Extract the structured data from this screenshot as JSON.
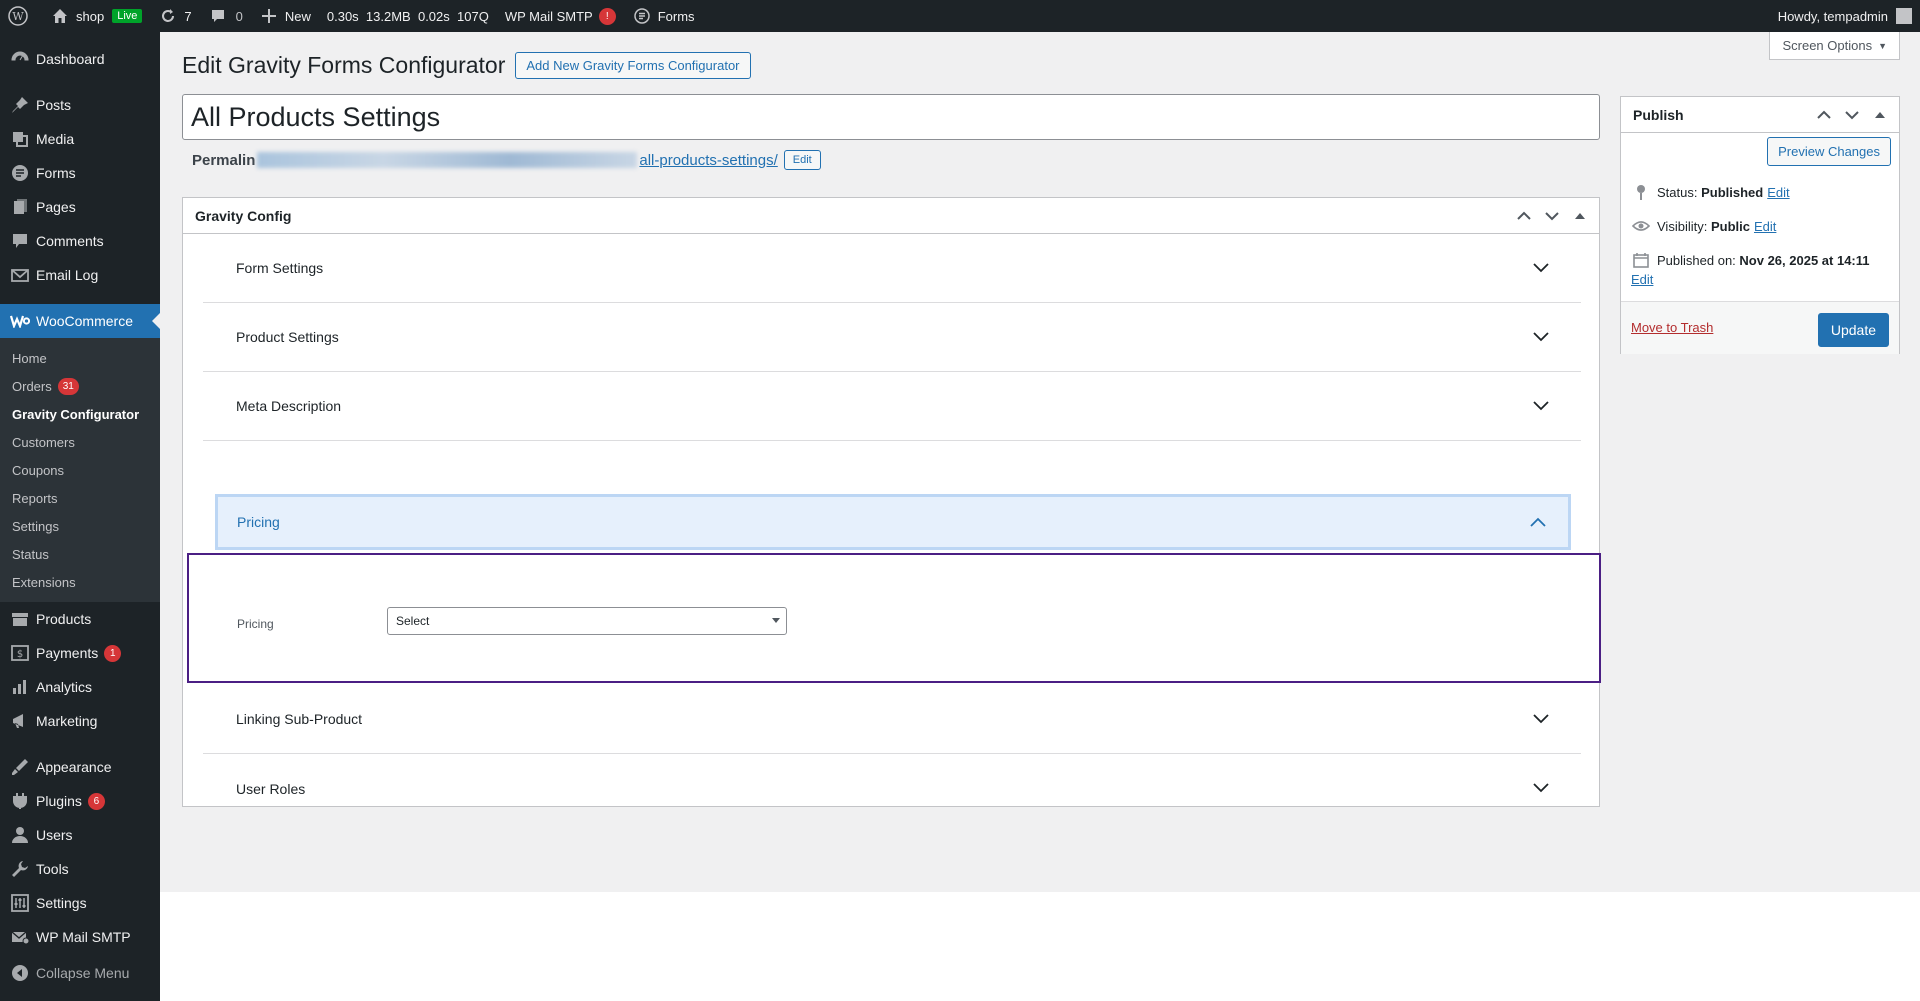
{
  "adminbar": {
    "site_name": "shop",
    "live_label": "Live",
    "updates_count": "7",
    "comments_count": "0",
    "new_label": "New",
    "perf": [
      "0.30s",
      "13.2MB",
      "0.02s",
      "107Q"
    ],
    "smtp_label": "WP Mail SMTP",
    "smtp_alert": "!",
    "forms_label": "Forms",
    "howdy": "Howdy, tempadmin"
  },
  "sidebar": {
    "items_top": [
      {
        "label": "Dashboard",
        "icon": "dashboard-icon"
      }
    ],
    "items_content": [
      {
        "label": "Posts",
        "icon": "pin-icon"
      },
      {
        "label": "Media",
        "icon": "media-icon"
      },
      {
        "label": "Forms",
        "icon": "forms-icon"
      },
      {
        "label": "Pages",
        "icon": "pages-icon"
      },
      {
        "label": "Comments",
        "icon": "comment-icon"
      },
      {
        "label": "Email Log",
        "icon": "email-icon"
      }
    ],
    "woocommerce": {
      "label": "WooCommerce",
      "icon": "woocommerce-icon"
    },
    "woo_sub": [
      {
        "label": "Home"
      },
      {
        "label": "Orders",
        "badge": "31"
      },
      {
        "label": "Gravity Configurator",
        "current": true
      },
      {
        "label": "Customers"
      },
      {
        "label": "Coupons"
      },
      {
        "label": "Reports"
      },
      {
        "label": "Settings"
      },
      {
        "label": "Status"
      },
      {
        "label": "Extensions"
      }
    ],
    "items_store": [
      {
        "label": "Products",
        "icon": "products-icon"
      },
      {
        "label": "Payments",
        "icon": "payments-icon",
        "badge": "1"
      },
      {
        "label": "Analytics",
        "icon": "analytics-icon"
      },
      {
        "label": "Marketing",
        "icon": "marketing-icon"
      }
    ],
    "items_admin": [
      {
        "label": "Appearance",
        "icon": "appearance-icon"
      },
      {
        "label": "Plugins",
        "icon": "plugins-icon",
        "badge": "6"
      },
      {
        "label": "Users",
        "icon": "users-icon"
      },
      {
        "label": "Tools",
        "icon": "tools-icon"
      },
      {
        "label": "Settings",
        "icon": "settings-icon"
      },
      {
        "label": "WP Mail SMTP",
        "icon": "mail-icon"
      }
    ],
    "collapse_label": "Collapse Menu"
  },
  "screen_options": "Screen Options",
  "page": {
    "title": "Edit Gravity Forms Configurator",
    "add_new": "Add New Gravity Forms Configurator",
    "post_title": "All Products Settings",
    "permalink_label": "Permalin",
    "permalink_slug": "all-products-settings/",
    "permalink_edit": "Edit"
  },
  "gravity_config": {
    "title": "Gravity Config",
    "sections": [
      {
        "label": "Form Settings"
      },
      {
        "label": "Product Settings"
      },
      {
        "label": "Meta Description"
      },
      {
        "label": "Pricing",
        "expanded": true
      },
      {
        "label": "Linking Sub-Product"
      },
      {
        "label": "User Roles"
      }
    ],
    "pricing_field_label": "Pricing",
    "pricing_select_value": "Select"
  },
  "publish": {
    "title": "Publish",
    "preview": "Preview Changes",
    "status_label": "Status:",
    "status_value": "Published",
    "visibility_label": "Visibility:",
    "visibility_value": "Public",
    "published_label": "Published on:",
    "published_value": "Nov 26, 2025 at 14:11",
    "edit": "Edit",
    "trash": "Move to Trash",
    "update": "Update"
  }
}
